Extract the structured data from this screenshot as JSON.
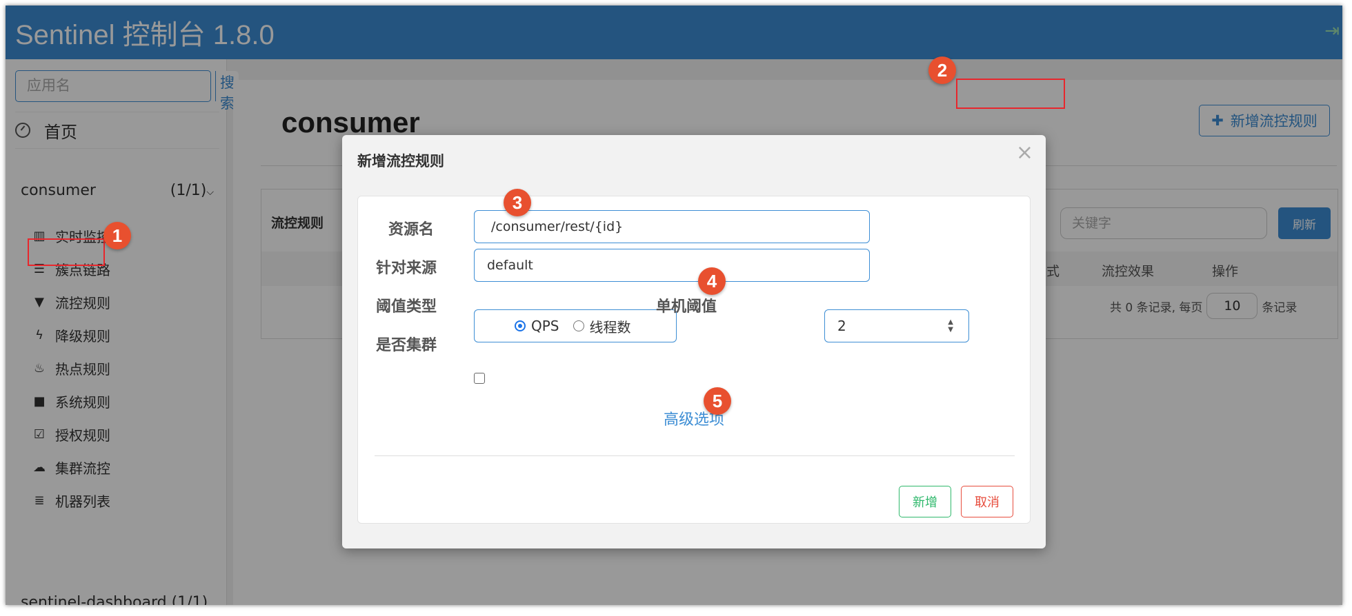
{
  "app": {
    "brand": "Sentinel 控制台 1.8.0"
  },
  "sidebar": {
    "search_placeholder": "应用名",
    "search_button": "搜索",
    "home": "首页",
    "app_name": "consumer",
    "app_count": "(1/1)",
    "items": [
      {
        "label": "实时监控",
        "icon": "bar-chart-icon"
      },
      {
        "label": "簇点链路",
        "icon": "list-icon"
      },
      {
        "label": "流控规则",
        "icon": "filter-icon"
      },
      {
        "label": "降级规则",
        "icon": "flash-icon"
      },
      {
        "label": "热点规则",
        "icon": "fire-icon"
      },
      {
        "label": "系统规则",
        "icon": "lock-icon"
      },
      {
        "label": "授权规则",
        "icon": "check-square-icon"
      },
      {
        "label": "集群流控",
        "icon": "cloud-icon"
      },
      {
        "label": "机器列表",
        "icon": "th-list-icon"
      }
    ],
    "app_name_2": "sentinel-dashboard",
    "app_count_2": "(1/1)"
  },
  "main": {
    "title": "consumer",
    "add_button": "新增流控规则",
    "panel_title": "流控规则",
    "keyword_placeholder": "关键字",
    "refresh_button": "刷新",
    "columns": {
      "mode": "值模式",
      "effect": "流控效果",
      "ops": "操作"
    },
    "pager": {
      "prefix": "共 0 条记录, 每页",
      "size": "10",
      "suffix": "条记录"
    }
  },
  "modal": {
    "title": "新增流控规则",
    "close": "×",
    "resource_label": "资源名",
    "resource_value": "/consumer/rest/{id}",
    "source_label": "针对来源",
    "source_value": "default",
    "threshold_type_label": "阈值类型",
    "threshold_type_options": [
      "QPS",
      "线程数"
    ],
    "threshold_type_selected": "QPS",
    "threshold_label": "单机阈值",
    "threshold_value": "2",
    "cluster_label": "是否集群",
    "cluster_checked": false,
    "advanced_link": "高级选项",
    "save_button": "新增",
    "cancel_button": "取消"
  },
  "annotations": [
    "1",
    "2",
    "3",
    "4",
    "5"
  ],
  "colors": {
    "navbar": "#3c8dd4",
    "accent": "#3c8dd4",
    "highlight": "#e8262c",
    "badge": "#e8502f",
    "save": "#2eb86b",
    "cancel": "#e74c3c"
  }
}
